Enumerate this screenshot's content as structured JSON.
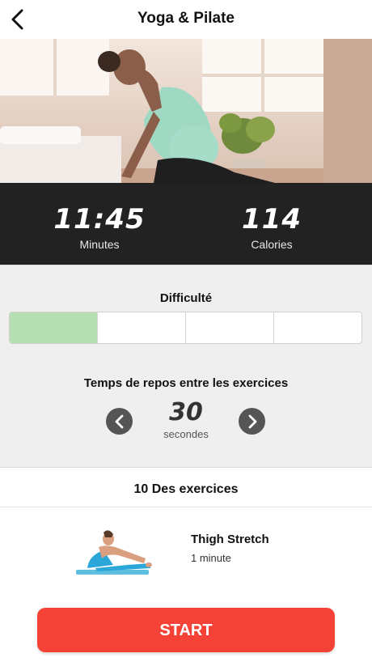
{
  "header": {
    "title": "Yoga & Pilate",
    "back_icon": "chevron-left-icon"
  },
  "stats": {
    "duration": {
      "value": "11:45",
      "label": "Minutes"
    },
    "calories": {
      "value": "114",
      "label": "Calories"
    }
  },
  "difficulty": {
    "title": "Difficulté",
    "level": 1,
    "levels_total": 4,
    "active_color": "#b5dfb2"
  },
  "rest": {
    "title": "Temps de repos entre les exercices",
    "value": "30",
    "unit": "secondes",
    "decrease_icon": "chevron-left-icon",
    "increase_icon": "chevron-right-icon"
  },
  "exercises": {
    "header": "10 Des exercices",
    "items": [
      {
        "name": "Thigh Stretch",
        "duration": "1 minute",
        "icon": "seated-forward-bend-figure"
      }
    ]
  },
  "start_button": {
    "label": "START",
    "color": "#f44336"
  },
  "theme": {
    "stats_bg": "#222222",
    "settings_bg": "#efefef"
  }
}
